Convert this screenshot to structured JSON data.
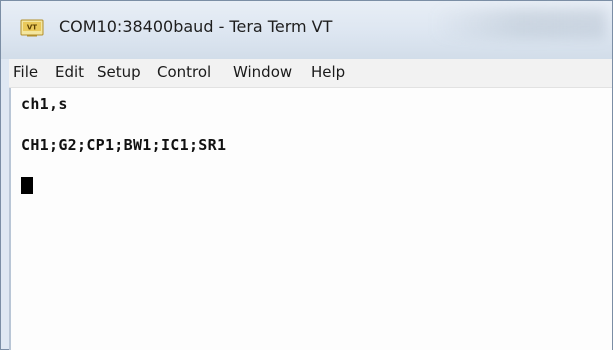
{
  "window": {
    "title": "COM10:38400baud - Tera Term VT",
    "icon": "tera-term-vt-icon",
    "icon_label": "VT"
  },
  "menubar": {
    "items": [
      {
        "label": "File"
      },
      {
        "label": "Edit"
      },
      {
        "label": "Setup"
      },
      {
        "label": "Control"
      },
      {
        "label": "Window"
      },
      {
        "label": "Help"
      }
    ]
  },
  "terminal": {
    "lines": [
      "ch1,s",
      "CH1;G2;CP1;BW1;IC1;SR1"
    ],
    "cursor": "block"
  },
  "colors": {
    "titlebar": "#dde6f1",
    "menubar": "#f2f2f2",
    "terminal_bg": "#fdfdfd",
    "terminal_text": "#111111"
  }
}
